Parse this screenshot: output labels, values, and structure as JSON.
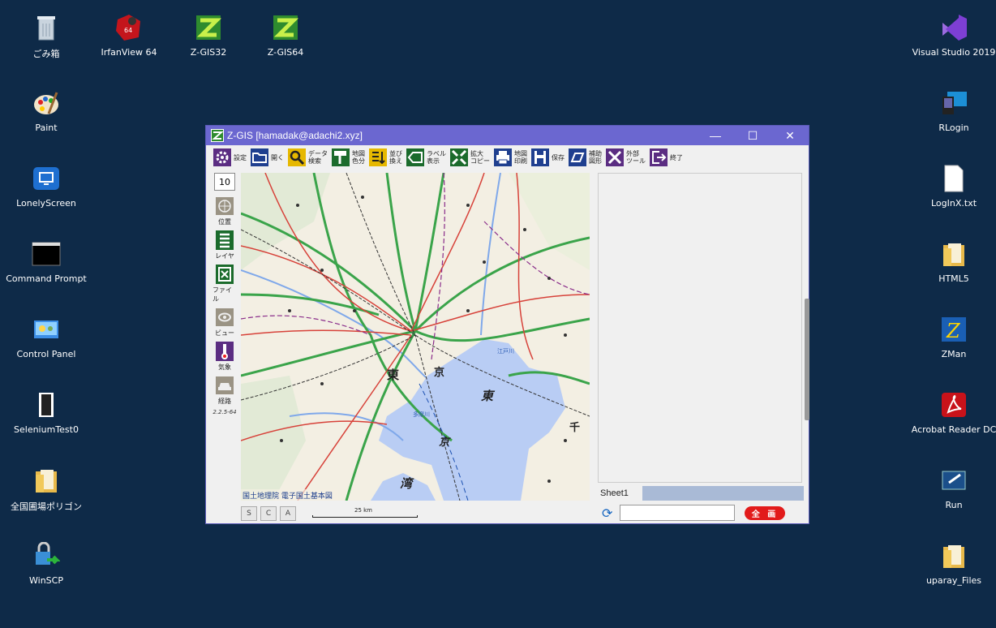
{
  "desktop_left": [
    {
      "label": "ごみ箱",
      "icon": "recycle-bin-icon"
    },
    {
      "label": "Paint",
      "icon": "paint-icon"
    },
    {
      "label": "LonelyScreen",
      "icon": "monitor-icon"
    },
    {
      "label": "Command Prompt",
      "icon": "terminal-icon"
    },
    {
      "label": "Control Panel",
      "icon": "control-panel-icon"
    },
    {
      "label": "SeleniumTest0",
      "icon": "exe-icon"
    },
    {
      "label": "全国圃場ポリゴン",
      "icon": "folder-icon"
    },
    {
      "label": "WinSCP",
      "icon": "winscp-icon"
    }
  ],
  "desktop_top": [
    {
      "label": "IrfanView 64",
      "icon": "irfanview-icon"
    },
    {
      "label": "Z-GIS32",
      "icon": "zgis-icon"
    },
    {
      "label": "Z-GIS64",
      "icon": "zgis-icon"
    }
  ],
  "desktop_right": [
    {
      "label": "Visual Studio 2019",
      "icon": "visual-studio-icon"
    },
    {
      "label": "RLogin",
      "icon": "rlogin-icon"
    },
    {
      "label": "LogInX.txt",
      "icon": "text-file-icon"
    },
    {
      "label": "HTML5",
      "icon": "folder-icon"
    },
    {
      "label": "ZMan",
      "icon": "zman-icon"
    },
    {
      "label": "Acrobat Reader DC",
      "icon": "acrobat-icon"
    },
    {
      "label": "Run",
      "icon": "run-icon"
    },
    {
      "label": "uparay_Files",
      "icon": "folder-icon"
    }
  ],
  "window": {
    "title": "Z-GIS [hamadak@adachi2.xyz]",
    "minimize": "—",
    "maximize": "☐",
    "close": "✕"
  },
  "toolbar": [
    {
      "label": "設定",
      "icon": "gear-icon",
      "color": "#5b2d82"
    },
    {
      "label": "開く",
      "icon": "folder-open-icon",
      "color": "#1f3f8f"
    },
    {
      "label": "データ\n検索",
      "icon": "search-icon",
      "color": "#e6b800"
    },
    {
      "label": "地図\n色分",
      "icon": "paint-roller-icon",
      "color": "#1b6b2c"
    },
    {
      "label": "並び\n換え",
      "icon": "sort-icon",
      "color": "#e6b800"
    },
    {
      "label": "ラベル\n表示",
      "icon": "label-icon",
      "color": "#1b6b2c"
    },
    {
      "label": "拡大\nコピー",
      "icon": "expand-icon",
      "color": "#1b6b2c"
    },
    {
      "label": "地図\n印刷",
      "icon": "printer-icon",
      "color": "#1f3f8f"
    },
    {
      "label": "保存",
      "icon": "save-icon",
      "color": "#1f3f8f"
    },
    {
      "label": "補助\n図形",
      "icon": "shape-icon",
      "color": "#1f3f8f"
    },
    {
      "label": "外部\nツール",
      "icon": "tools-icon",
      "color": "#5b2d82"
    },
    {
      "label": "終了",
      "icon": "exit-icon",
      "color": "#5b2d82"
    }
  ],
  "side": {
    "zoom": "10",
    "buttons": [
      {
        "label": "位置",
        "icon": "globe-icon",
        "color": "#9a9384"
      },
      {
        "label": "レイヤ",
        "icon": "layer-icon",
        "color": "#1b6b2c"
      },
      {
        "label": "ファイル",
        "icon": "file-x-icon",
        "color": "#1b6b2c"
      },
      {
        "label": "ビュー",
        "icon": "eye-icon",
        "color": "#9a9384"
      },
      {
        "label": "気象",
        "icon": "thermometer-icon",
        "color": "#5b2d82"
      },
      {
        "label": "経路",
        "icon": "car-icon",
        "color": "#9a9384"
      }
    ],
    "version": "2.2.5-64"
  },
  "map": {
    "attribution": "国土地理院 電子国土基本図",
    "scale_label": "25 km",
    "buttons": [
      "S",
      "C",
      "A"
    ],
    "labels": [
      "東",
      "京",
      "東",
      "京",
      "千",
      "湾",
      "多摩川",
      "江戸川"
    ]
  },
  "sheet": {
    "tab": "Sheet1",
    "input_value": "",
    "all_button": "全 画"
  },
  "colors": {
    "desktop": "#0e2a48",
    "titlebar": "#6b67d0",
    "water": "#b9cdf4",
    "road_green": "#3aa44a",
    "road_red": "#d7423a"
  }
}
